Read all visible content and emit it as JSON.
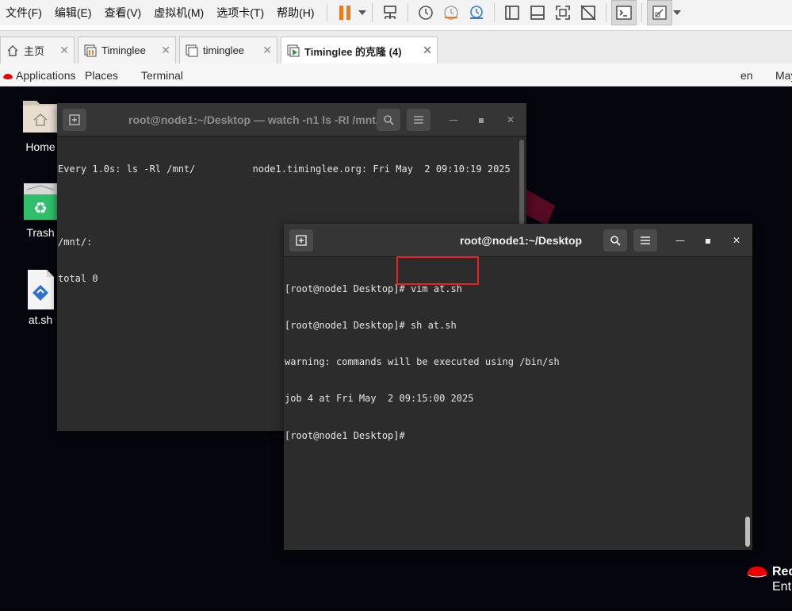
{
  "menubar": {
    "items": [
      "文件(F)",
      "编辑(E)",
      "查看(V)",
      "虚拟机(M)",
      "选项卡(T)",
      "帮助(H)"
    ]
  },
  "tabs": [
    {
      "label": "主页",
      "icon": "home-icon"
    },
    {
      "label": "Timinglee",
      "icon": "vm-icon"
    },
    {
      "label": "timinglee",
      "icon": "vm-icon"
    },
    {
      "label": "Timinglee 的克隆 (4)",
      "icon": "vm-running-icon",
      "active": true
    }
  ],
  "gnome": {
    "applications": "Applications",
    "places": "Places",
    "terminal": "Terminal",
    "lang": "en",
    "clock_partial": "May"
  },
  "desktop": {
    "icons": [
      {
        "label": "Home"
      },
      {
        "label": "Trash"
      },
      {
        "label": "at.sh"
      }
    ],
    "brand_line1": "Red",
    "brand_line2": "Ent"
  },
  "term_watch": {
    "title": "root@node1:~/Desktop — watch -n1 ls -Rl /mnt/",
    "lines": [
      "Every 1.0s: ls -Rl /mnt/          node1.timinglee.org: Fri May  2 09:10:19 2025",
      "",
      "/mnt/:",
      "total 0"
    ]
  },
  "term_main": {
    "title": "root@node1:~/Desktop",
    "lines": [
      "[root@node1 Desktop]# vim at.sh",
      "[root@node1 Desktop]# sh at.sh",
      "warning: commands will be executed using /bin/sh",
      "job 4 at Fri May  2 09:15:00 2025",
      "[root@node1 Desktop]#"
    ]
  },
  "colors": {
    "highlight": "#e8231f",
    "pause_accent": "#f07a1b",
    "redhat_red": "#ee0000"
  }
}
